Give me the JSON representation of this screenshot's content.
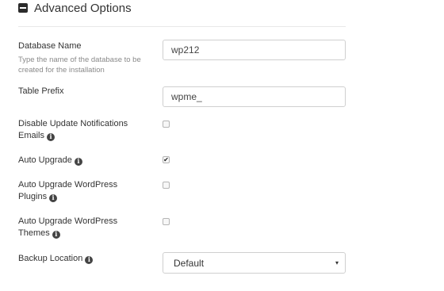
{
  "section": {
    "title": "Advanced Options",
    "icon": "minus-square-icon"
  },
  "fields": {
    "database_name": {
      "label": "Database Name",
      "help": "Type the name of the database to be created for the installation",
      "value": "wp212"
    },
    "table_prefix": {
      "label": "Table Prefix",
      "value": "wpme_"
    },
    "disable_update_emails": {
      "label": "Disable Update Notifications Emails",
      "checked": false
    },
    "auto_upgrade": {
      "label": "Auto Upgrade",
      "checked": true
    },
    "auto_upgrade_plugins": {
      "label": "Auto Upgrade WordPress Plugins",
      "checked": false
    },
    "auto_upgrade_themes": {
      "label": "Auto Upgrade WordPress Themes",
      "checked": false
    },
    "backup_location": {
      "label": "Backup Location",
      "selected": "Default"
    }
  },
  "icons": {
    "info": "info-circle-icon",
    "checkmark": "✔",
    "dropdown": "▾"
  }
}
